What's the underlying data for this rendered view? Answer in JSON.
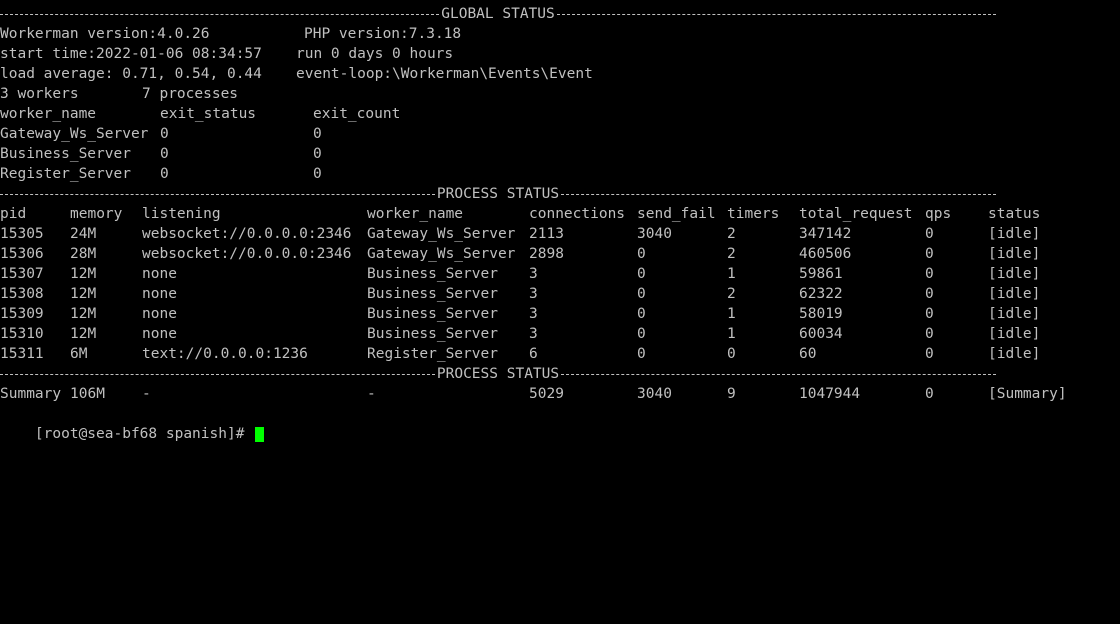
{
  "terminal": {
    "cursor_color": "#00ff00",
    "text_color": "#c0c0c0",
    "background_color": "#000000",
    "top_partial": "[ ... ]",
    "global_title": "GLOBAL STATUS",
    "workerman_version": "Workerman version:4.0.26",
    "php_version": "PHP version:7.3.18",
    "start_time": "start time:2022-01-06 08:34:57",
    "run_time": "run 0 days 0 hours",
    "load_average": "load average: 0.71, 0.54, 0.44",
    "event_loop": "event-loop:\\Workerman\\Events\\Event",
    "workers_count": "3 workers",
    "processes_count": "7 processes",
    "exit_headers": [
      "worker_name",
      "exit_status",
      "exit_count"
    ],
    "exit_rows": [
      [
        "Gateway_Ws_Server",
        "0",
        "0"
      ],
      [
        "Business_Server",
        "0",
        "0"
      ],
      [
        "Register_Server",
        "0",
        "0"
      ]
    ],
    "process_title": "PROCESS STATUS",
    "process_headers": [
      "pid",
      "memory",
      "listening",
      "worker_name",
      "connections",
      "send_fail",
      "timers",
      "total_request",
      "qps",
      "status"
    ],
    "process_rows": [
      [
        "15305",
        "24M",
        "websocket://0.0.0.0:2346",
        "Gateway_Ws_Server",
        "2113",
        "3040",
        "2",
        "347142",
        "0",
        "[idle]"
      ],
      [
        "15306",
        "28M",
        "websocket://0.0.0.0:2346",
        "Gateway_Ws_Server",
        "2898",
        "0",
        "2",
        "460506",
        "0",
        "[idle]"
      ],
      [
        "15307",
        "12M",
        "none",
        "Business_Server",
        "3",
        "0",
        "1",
        "59861",
        "0",
        "[idle]"
      ],
      [
        "15308",
        "12M",
        "none",
        "Business_Server",
        "3",
        "0",
        "2",
        "62322",
        "0",
        "[idle]"
      ],
      [
        "15309",
        "12M",
        "none",
        "Business_Server",
        "3",
        "0",
        "1",
        "58019",
        "0",
        "[idle]"
      ],
      [
        "15310",
        "12M",
        "none",
        "Business_Server",
        "3",
        "0",
        "1",
        "60034",
        "0",
        "[idle]"
      ],
      [
        "15311",
        "6M",
        "text://0.0.0.0:1236",
        "Register_Server",
        "6",
        "0",
        "0",
        "60",
        "0",
        "[idle]"
      ]
    ],
    "summary_row": [
      "Summary",
      "106M",
      "-",
      "-",
      "5029",
      "3040",
      "9",
      "1047944",
      "0",
      "[Summary]"
    ],
    "prompt": "[root@sea-bf68 spanish]# "
  }
}
